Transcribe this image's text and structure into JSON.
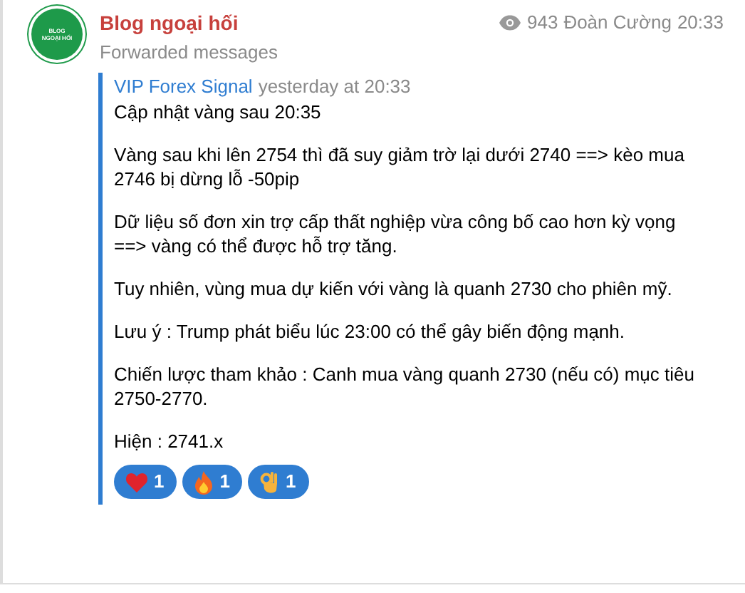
{
  "channel": {
    "name": "Blog ngoại hối",
    "subtitle": "Forwarded messages",
    "avatar_text": [
      "BLOG",
      "NGOẠI HỐI"
    ],
    "views": "943",
    "author": "Đoàn Cường",
    "time": "20:33"
  },
  "forwarded": {
    "source": "VIP Forex Signal",
    "date": "yesterday at 20:33",
    "paragraphs": [
      "Cập nhật vàng sau 20:35",
      "Vàng sau khi lên 2754 thì đã suy giảm trờ lại dưới 2740 ==> kèo mua 2746 bị dừng lỗ -50pip",
      "Dữ liệu số đơn xin trợ cấp thất nghiệp vừa công bố cao hơn kỳ vọng ==> vàng có thể được hỗ trợ tăng.",
      "Tuy nhiên, vùng mua dự kiến với vàng là quanh 2730 cho phiên mỹ.",
      "Lưu ý : Trump phát biểu lúc 23:00 có thể gây biến động mạnh.",
      "Chiến lược tham khảo : Canh mua vàng quanh 2730 (nếu có) mục tiêu 2750-2770.",
      "Hiện : 2741.x"
    ]
  },
  "reactions": [
    {
      "kind": "heart",
      "count": "1"
    },
    {
      "kind": "fire",
      "count": "1"
    },
    {
      "kind": "ok",
      "count": "1"
    }
  ]
}
